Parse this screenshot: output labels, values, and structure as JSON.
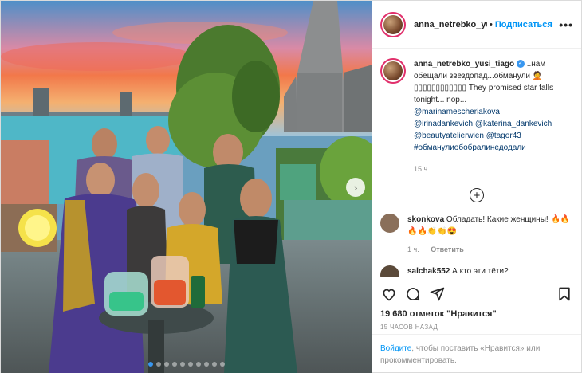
{
  "header": {
    "username": "anna_netrebko_yus",
    "dot": "•",
    "follow_label": "Подписаться",
    "more_icon": "more-dots-icon"
  },
  "caption": {
    "username": "anna_netrebko_yusi_tiago",
    "verified_glyph": "✓",
    "text": "..нам обещали звездопад...обманули 🤦 ▯▯▯▯▯▯▯▯▯▯▯▯ They promised star falls tonight... nop...",
    "tags": [
      "@marinamescheriakova",
      "@irinadankevich @katerina_dankevich",
      "@beautyatelierwien @tagor43",
      "#обманулиобобралинедодали"
    ],
    "time": "15 ч."
  },
  "comments": [
    {
      "username": "skonkova",
      "text": "Обладать! Какие женщины! 🔥🔥🔥🔥👏👏😍",
      "time": "1 ч.",
      "reply_label": "Ответить",
      "avatar_color": "#8a6f5a"
    },
    {
      "username": "salchak552",
      "text": "А кто эти тёти?",
      "avatar_color": "#5b4a3a"
    }
  ],
  "actions": {
    "likes": "19 680 отметок \"Нравится\"",
    "when": "15 ЧАСОВ НАЗАД"
  },
  "login": {
    "link": "Войдите",
    "text": ", чтобы поставить «Нравится» или прокомментировать."
  },
  "photo": {
    "dots_total": 10,
    "dots_active": 0
  }
}
